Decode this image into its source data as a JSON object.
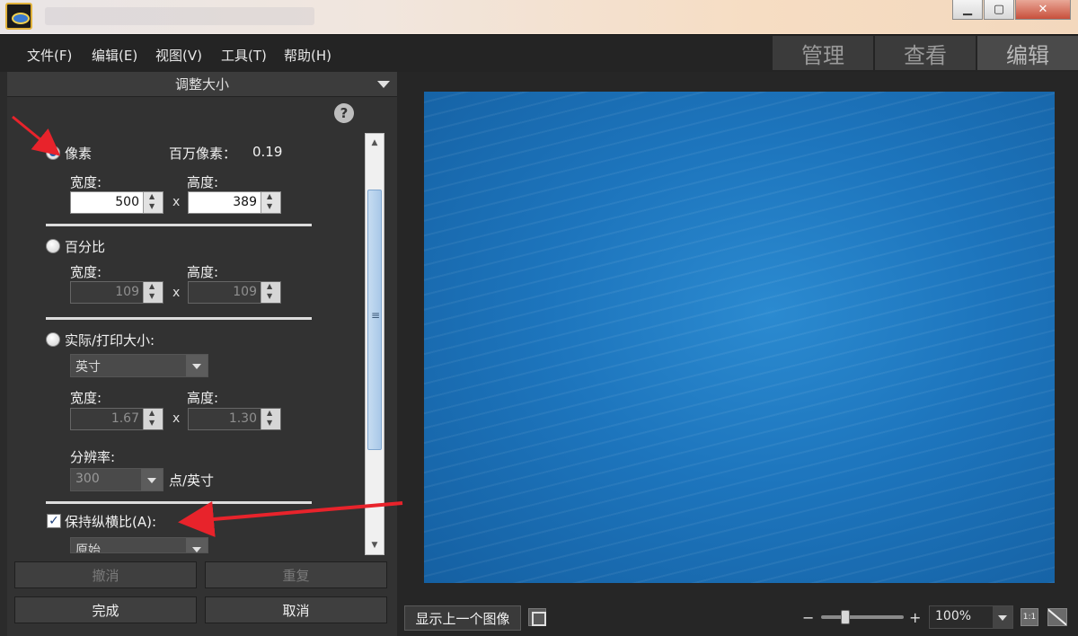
{
  "menu": {
    "file": "文件(F)",
    "edit": "编辑(E)",
    "view": "视图(V)",
    "tools": "工具(T)",
    "help": "帮助(H)"
  },
  "modes": {
    "manage": "管理",
    "view": "查看",
    "edit": "编辑",
    "active": "编辑"
  },
  "panel": {
    "title": "调整大小",
    "help_icon": "?",
    "pixels": {
      "label": "像素",
      "megapixels_label": "百万像素：",
      "megapixels_value": "0.19",
      "width_label": "宽度:",
      "height_label": "高度:",
      "width": "500",
      "height": "389",
      "x": "x"
    },
    "percent": {
      "label": "百分比",
      "width_label": "宽度:",
      "height_label": "高度:",
      "width": "109",
      "height": "109",
      "x": "x"
    },
    "print": {
      "label": "实际/打印大小:",
      "unit": "英寸",
      "width_label": "宽度:",
      "height_label": "高度:",
      "width": "1.67",
      "height": "1.30",
      "x": "x",
      "resolution_label": "分辨率:",
      "resolution": "300",
      "resolution_unit": "点/英寸"
    },
    "keep_aspect": {
      "label": "保持纵横比(A):",
      "checked": true,
      "mode": "原始"
    },
    "buttons": {
      "undo": "撤消",
      "redo": "重复",
      "done": "完成",
      "cancel": "取消"
    }
  },
  "viewer": {
    "prev_image": "显示上一个图像",
    "zoom_out": "−",
    "zoom_in": "+",
    "zoom_level": "100%",
    "one_to_one": "1:1"
  },
  "colors": {
    "arrow": "#e8232b",
    "image_blue": "#1d75bd"
  }
}
